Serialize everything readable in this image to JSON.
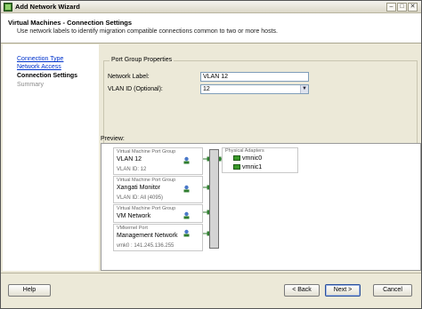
{
  "window": {
    "title": "Add Network Wizard",
    "minimize_glyph": "–",
    "maximize_glyph": "□",
    "close_glyph": "✕"
  },
  "header": {
    "title": "Virtual Machines - Connection Settings",
    "subtitle": "Use network labels to identify migration compatible connections common to two or more hosts."
  },
  "nav": {
    "items": [
      {
        "label": "Connection Type",
        "state": "link"
      },
      {
        "label": "Network Access",
        "state": "link"
      },
      {
        "label": "Connection Settings",
        "state": "current"
      },
      {
        "label": "Summary",
        "state": "future"
      }
    ]
  },
  "form": {
    "group_title": "Port Group Properties",
    "network_label_caption": "Network Label:",
    "network_label_value": "VLAN 12",
    "vlan_id_caption": "VLAN ID (Optional):",
    "vlan_id_value": "12"
  },
  "preview": {
    "caption": "Preview:",
    "port_groups": [
      {
        "type": "Virtual Machine Port Group",
        "name": "VLAN 12",
        "sub": "VLAN ID: 12"
      },
      {
        "type": "Virtual Machine Port Group",
        "name": "Xangati Monitor",
        "sub": "VLAN ID: All (4095)"
      },
      {
        "type": "Virtual Machine Port Group",
        "name": "VM Network",
        "sub": ""
      },
      {
        "type": "VMkernel Port",
        "name": "Management Network",
        "sub": "vmk0 : 141.245.136.255"
      }
    ],
    "adapters_title": "Physical Adapters",
    "adapters": [
      "vmnic0",
      "vmnic1"
    ]
  },
  "buttons": {
    "help": "Help",
    "back": "< Back",
    "next": "Next >",
    "cancel": "Cancel"
  },
  "colors": {
    "link": "#0033cc",
    "nic": "#3a9a2a",
    "wizard_bg": "#ece9d8"
  }
}
